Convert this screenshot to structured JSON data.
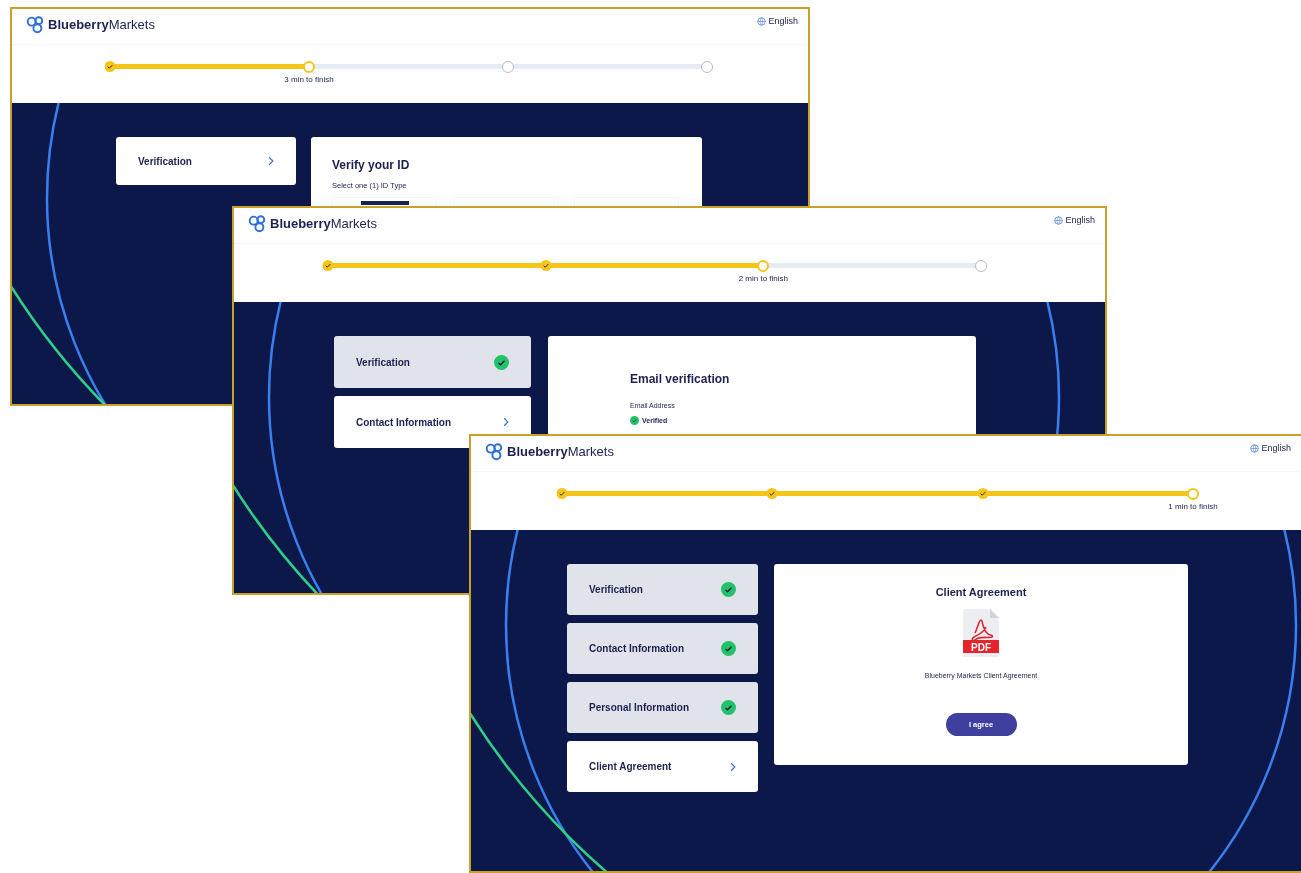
{
  "windows": [
    {
      "logo": "**Blueberry**Markets",
      "language": "English",
      "steps": [
        {
          "done": true,
          "current": false
        },
        {
          "done": false,
          "current": true
        },
        {
          "done": false,
          "current": false
        },
        {
          "done": false,
          "current": false
        }
      ],
      "time_left": "3 min to finish",
      "sidebar": [
        {
          "label": "Verification",
          "completed": false
        }
      ],
      "card": {
        "kind": "id_select",
        "title": "Verify your ID",
        "subtitle": "Select one (1) ID Type"
      }
    },
    {
      "logo": "**Blueberry**Markets",
      "language": "English",
      "steps": [
        {
          "done": true,
          "current": false
        },
        {
          "done": true,
          "current": false
        },
        {
          "done": false,
          "current": true
        },
        {
          "done": false,
          "current": false
        }
      ],
      "time_left": "2 min to finish",
      "sidebar": [
        {
          "label": "Verification",
          "completed": true
        },
        {
          "label": "Contact Information",
          "completed": false
        }
      ],
      "card": {
        "kind": "email",
        "title": "Email verification",
        "field_label": "Email Address",
        "status": "Verified"
      }
    },
    {
      "logo": "**Blueberry**Markets",
      "language": "English",
      "steps": [
        {
          "done": true,
          "current": false
        },
        {
          "done": true,
          "current": false
        },
        {
          "done": true,
          "current": false
        },
        {
          "done": false,
          "current": true
        }
      ],
      "time_left": "1 min to finish",
      "sidebar": [
        {
          "label": "Verification",
          "completed": true
        },
        {
          "label": "Contact Information",
          "completed": true
        },
        {
          "label": "Personal Information",
          "completed": true
        },
        {
          "label": "Client Agreement",
          "completed": false
        }
      ],
      "card": {
        "kind": "agreement",
        "title": "Client Agreement",
        "icon_label": "PDF",
        "document": "Blueberry Markets Client Agreement",
        "button": "I agree"
      }
    }
  ]
}
